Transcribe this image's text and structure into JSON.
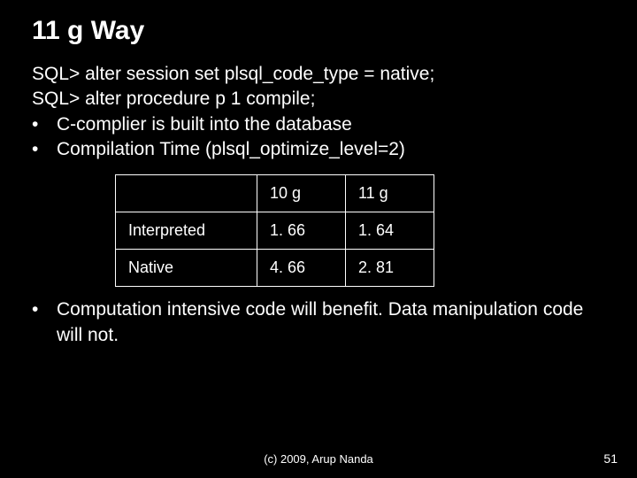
{
  "title": "11 g Way",
  "lines": {
    "l1": "SQL> alter session set plsql_code_type = native;",
    "l2": "SQL> alter procedure p 1 compile;"
  },
  "bullets": {
    "b1": "C-complier is built into the database",
    "b2": "Compilation Time (plsql_optimize_level=2)",
    "b3": "Computation intensive code will benefit. Data manipulation code will not."
  },
  "bullet_char": "•",
  "table": {
    "r0c0": "",
    "r0c1": "10 g",
    "r0c2": "11 g",
    "r1c0": "Interpreted",
    "r1c1": "1. 66",
    "r1c2": "1. 64",
    "r2c0": "Native",
    "r2c1": "4. 66",
    "r2c2": "2. 81"
  },
  "footer": {
    "center": "(c) 2009, Arup Nanda",
    "right": "51"
  },
  "chart_data": {
    "type": "table",
    "title": "Compilation Time (plsql_optimize_level=2)",
    "columns": [
      "",
      "10 g",
      "11 g"
    ],
    "rows": [
      {
        "label": "Interpreted",
        "values": [
          1.66,
          1.64
        ]
      },
      {
        "label": "Native",
        "values": [
          4.66,
          2.81
        ]
      }
    ]
  }
}
